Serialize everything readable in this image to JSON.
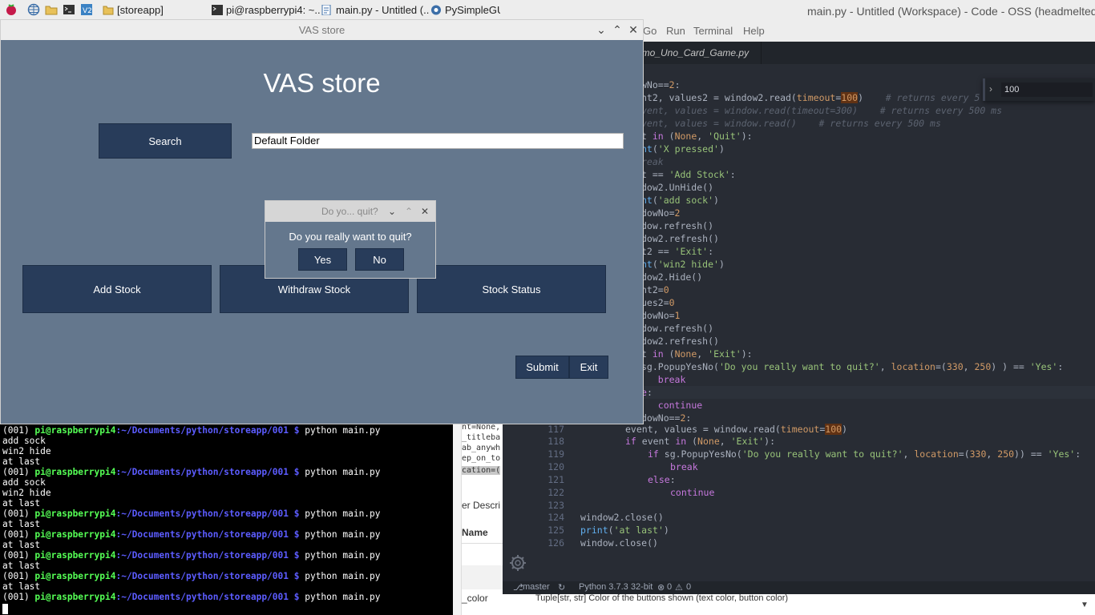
{
  "taskbar": {
    "tasks": [
      {
        "icon": "folder-icon",
        "label": "[storeapp]"
      },
      {
        "icon": "terminal-icon",
        "label": "pi@raspberrypi4: ~..."
      },
      {
        "icon": "vscode-file-icon",
        "label": "main.py - Untitled (..."
      },
      {
        "icon": "pysimplegui-icon",
        "label": "PySimpleGU"
      }
    ]
  },
  "vscode": {
    "title": "main.py - Untitled (Workspace) - Code - OSS (headmelted)",
    "menu": [
      "Go",
      "Run",
      "Terminal",
      "Help"
    ],
    "tab": "emo_Uno_Card_Game.py",
    "find_value": "100",
    "status": {
      "branch": "master",
      "python": "Python 3.7.3 32-bit",
      "errors": "0",
      "warnings": "0"
    },
    "below_text": "Tuple[str, str] Color of the buttons shown (text color, button color)",
    "lines": {
      "l116_ln": "116",
      "l117_ln": "117",
      "l118_ln": "118",
      "l119_ln": "119",
      "l120_ln": "120",
      "l121_ln": "121",
      "l122_ln": "122",
      "l123_ln": "123",
      "l124_ln": "124",
      "l125_ln": "125",
      "l126_ln": "126"
    }
  },
  "docs": {
    "lines": [
      "nt=None,",
      "_titleba",
      "ab_anywh",
      "ep_on_to",
      "cation=("
    ],
    "label": "er Descri",
    "header": "Name",
    "row": "_color"
  },
  "terminal": {
    "prompt_user": "pi@raspberrypi4",
    "prompt_path": ":~/Documents/python/storeapp/001 $ ",
    "env": "(001) ",
    "command": "python main.py",
    "output": [
      "add sock",
      "win2 hide",
      "at last"
    ]
  },
  "vas": {
    "window_title": "VAS store",
    "heading": "VAS store",
    "search_label": "Search",
    "folder_value": "Default Folder",
    "add_stock": "Add Stock",
    "withdraw_stock": "Withdraw Stock",
    "stock_status": "Stock Status",
    "submit": "Submit",
    "exit": "Exit"
  },
  "popup": {
    "title": "Do yo... quit?",
    "message": "Do you really want to quit?",
    "yes": "Yes",
    "no": "No"
  }
}
